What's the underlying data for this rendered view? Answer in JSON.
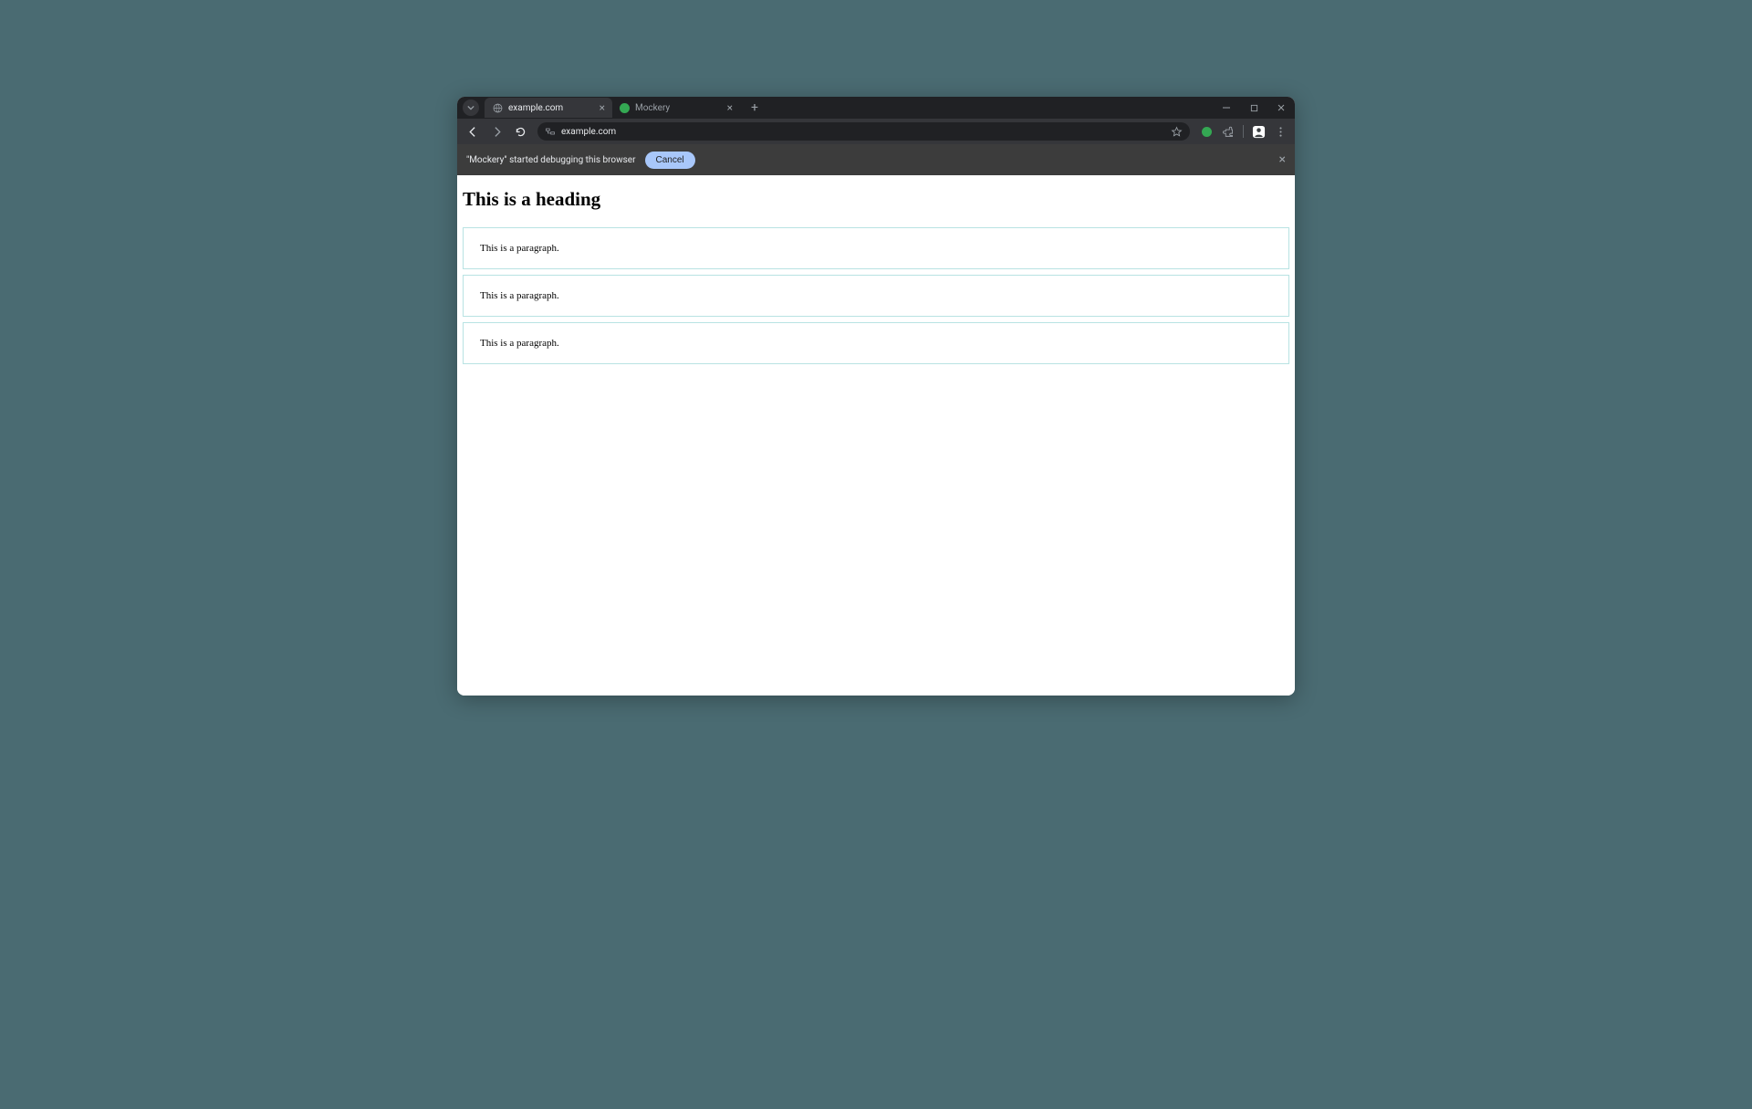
{
  "tabs": [
    {
      "title": "example.com",
      "active": true,
      "favicon": "globe"
    },
    {
      "title": "Mockery",
      "active": false,
      "favicon": "green"
    }
  ],
  "addressbar": {
    "url": "example.com"
  },
  "debugbar": {
    "message": "\"Mockery\" started debugging this browser",
    "cancel_label": "Cancel"
  },
  "page": {
    "heading": "This is a heading",
    "paragraphs": [
      "This is a paragraph.",
      "This is a paragraph.",
      "This is a paragraph."
    ]
  }
}
